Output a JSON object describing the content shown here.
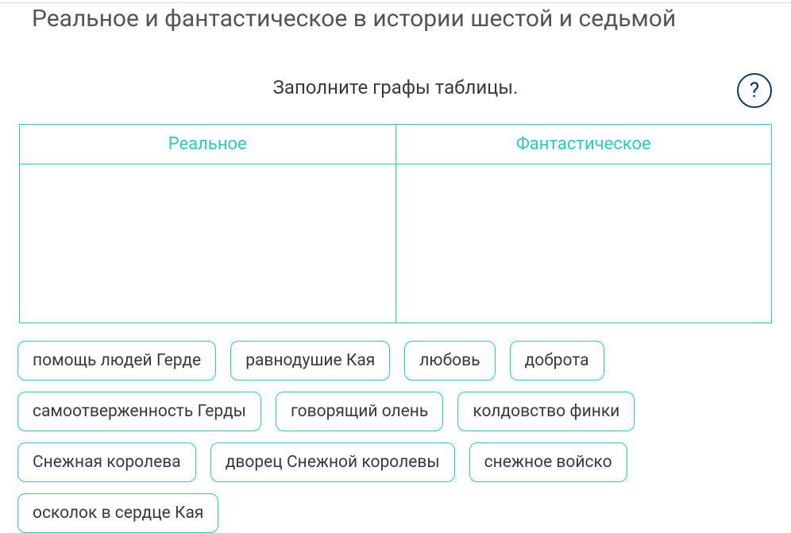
{
  "title": "Реальное и фантастическое в истории шестой и седьмой",
  "instruction": "Заполните графы таблицы.",
  "help_glyph": "?",
  "table": {
    "columns": [
      "Реальное",
      "Фантастическое"
    ]
  },
  "chips": [
    "помощь людей Герде",
    "равнодушие Кая",
    "любовь",
    "доброта",
    "самоотверженность Герды",
    "говорящий олень",
    "колдовство финки",
    "Снежная королева",
    "дворец Снежной королевы",
    "снежное войско",
    "осколок в сердце Кая"
  ],
  "colors": {
    "accent": "#2ec7bd",
    "help_ring": "#0a3a6a"
  }
}
